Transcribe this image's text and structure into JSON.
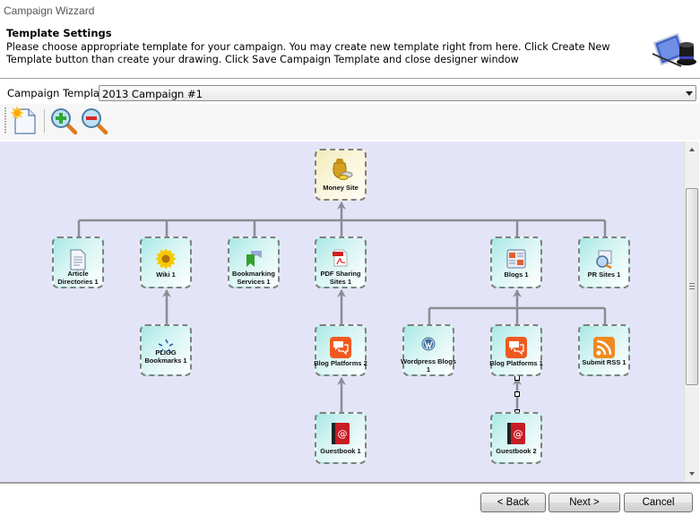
{
  "window": {
    "title": "Campaign Wizzard"
  },
  "header": {
    "title": "Template Settings",
    "description": "Please choose appropriate template for your campaign. You may create new template right from here. Click Create New Template button  than create your drawing. Click Save Campaign Template and close designer window",
    "icon": "wizard-hat-icon"
  },
  "template": {
    "label": "Campaign Template:",
    "selected": "2013 Campaign #1"
  },
  "toolbar": {
    "items": [
      {
        "name": "new-template-button",
        "icon": "new-document-icon"
      },
      {
        "name": "zoom-in-button",
        "icon": "zoom-in-icon"
      },
      {
        "name": "zoom-out-button",
        "icon": "zoom-out-icon"
      }
    ]
  },
  "diagram": {
    "nodes": [
      {
        "id": "money",
        "label": "Money Site",
        "icon": "money-bag-icon",
        "root": true
      },
      {
        "id": "article",
        "label": "Article Directories 1",
        "icon": "document-icon"
      },
      {
        "id": "wiki",
        "label": "Wiki 1",
        "icon": "sunflower-icon"
      },
      {
        "id": "bookmarking",
        "label": "Bookmarking Services 1",
        "icon": "bookmark-ribbon-icon"
      },
      {
        "id": "pdf",
        "label": "PDF Sharing Sites 1",
        "icon": "pdf-icon"
      },
      {
        "id": "blogs",
        "label": "Blogs 1",
        "icon": "blog-page-icon"
      },
      {
        "id": "pr",
        "label": "PR Sites 1",
        "icon": "press-release-icon"
      },
      {
        "id": "pligg",
        "label": "PLIGG Bookmarks 1",
        "icon": "pligg-icon"
      },
      {
        "id": "blogplat2",
        "label": "Blog Platforms 2",
        "icon": "chat-bubbles-icon"
      },
      {
        "id": "wordpress",
        "label": "Wordpress Blogs 1",
        "icon": "wordpress-icon"
      },
      {
        "id": "blogplat1",
        "label": "Blog Platforms 1",
        "icon": "chat-bubbles-icon"
      },
      {
        "id": "rss",
        "label": "Submit RSS 1",
        "icon": "rss-icon"
      },
      {
        "id": "guest1",
        "label": "Guestbook 1",
        "icon": "guestbook-icon"
      },
      {
        "id": "guest2",
        "label": "Guestbook 2",
        "icon": "guestbook-icon"
      }
    ],
    "edges": [
      {
        "from": "article",
        "to": "money"
      },
      {
        "from": "wiki",
        "to": "money"
      },
      {
        "from": "bookmarking",
        "to": "money"
      },
      {
        "from": "pdf",
        "to": "money"
      },
      {
        "from": "blogs",
        "to": "money"
      },
      {
        "from": "pr",
        "to": "money"
      },
      {
        "from": "pligg",
        "to": "wiki"
      },
      {
        "from": "blogplat2",
        "to": "pdf"
      },
      {
        "from": "wordpress",
        "to": "blogs"
      },
      {
        "from": "blogplat1",
        "to": "blogs"
      },
      {
        "from": "rss",
        "to": "blogs"
      },
      {
        "from": "guest1",
        "to": "blogplat2"
      },
      {
        "from": "guest2",
        "to": "blogplat1",
        "selected": true
      }
    ]
  },
  "footer": {
    "back": "< Back",
    "next": "Next >",
    "cancel": "Cancel"
  },
  "colors": {
    "canvas": "#e4e4f8",
    "edge": "#8c8c94",
    "node_border": "#808080"
  }
}
